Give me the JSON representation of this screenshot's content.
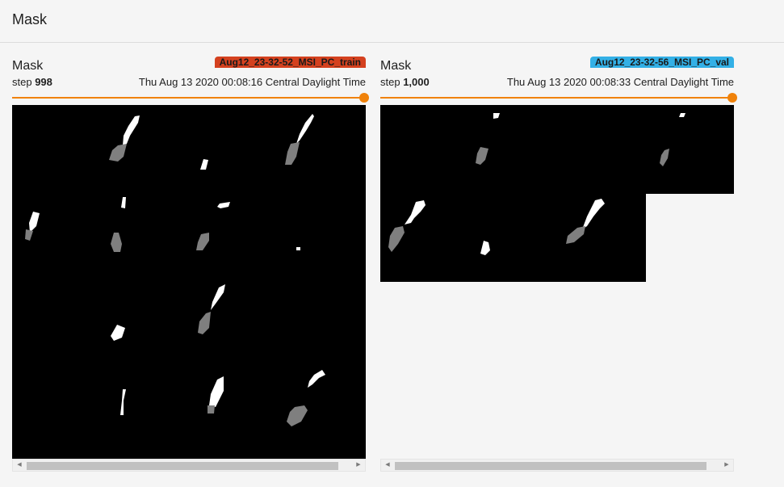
{
  "section": {
    "title": "Mask"
  },
  "cards": [
    {
      "title": "Mask",
      "run_tag": "Aug12_23-32-52_MSI_PC_train",
      "run_color": "#d4411f",
      "step_label": "step",
      "step_value": "998",
      "timestamp": "Thu Aug 13 2020 00:08:16 Central Daylight Time",
      "slider_color": "#f0820a",
      "scroll_left_icon": "◀",
      "scroll_right_icon": "▶"
    },
    {
      "title": "Mask",
      "run_tag": "Aug12_23-32-56_MSI_PC_val",
      "run_color": "#33b0e6",
      "step_label": "step",
      "step_value": "1,000",
      "timestamp": "Thu Aug 13 2020 00:08:33 Central Daylight Time",
      "slider_color": "#f0820a",
      "scroll_left_icon": "◀",
      "scroll_right_icon": "▶"
    }
  ]
}
